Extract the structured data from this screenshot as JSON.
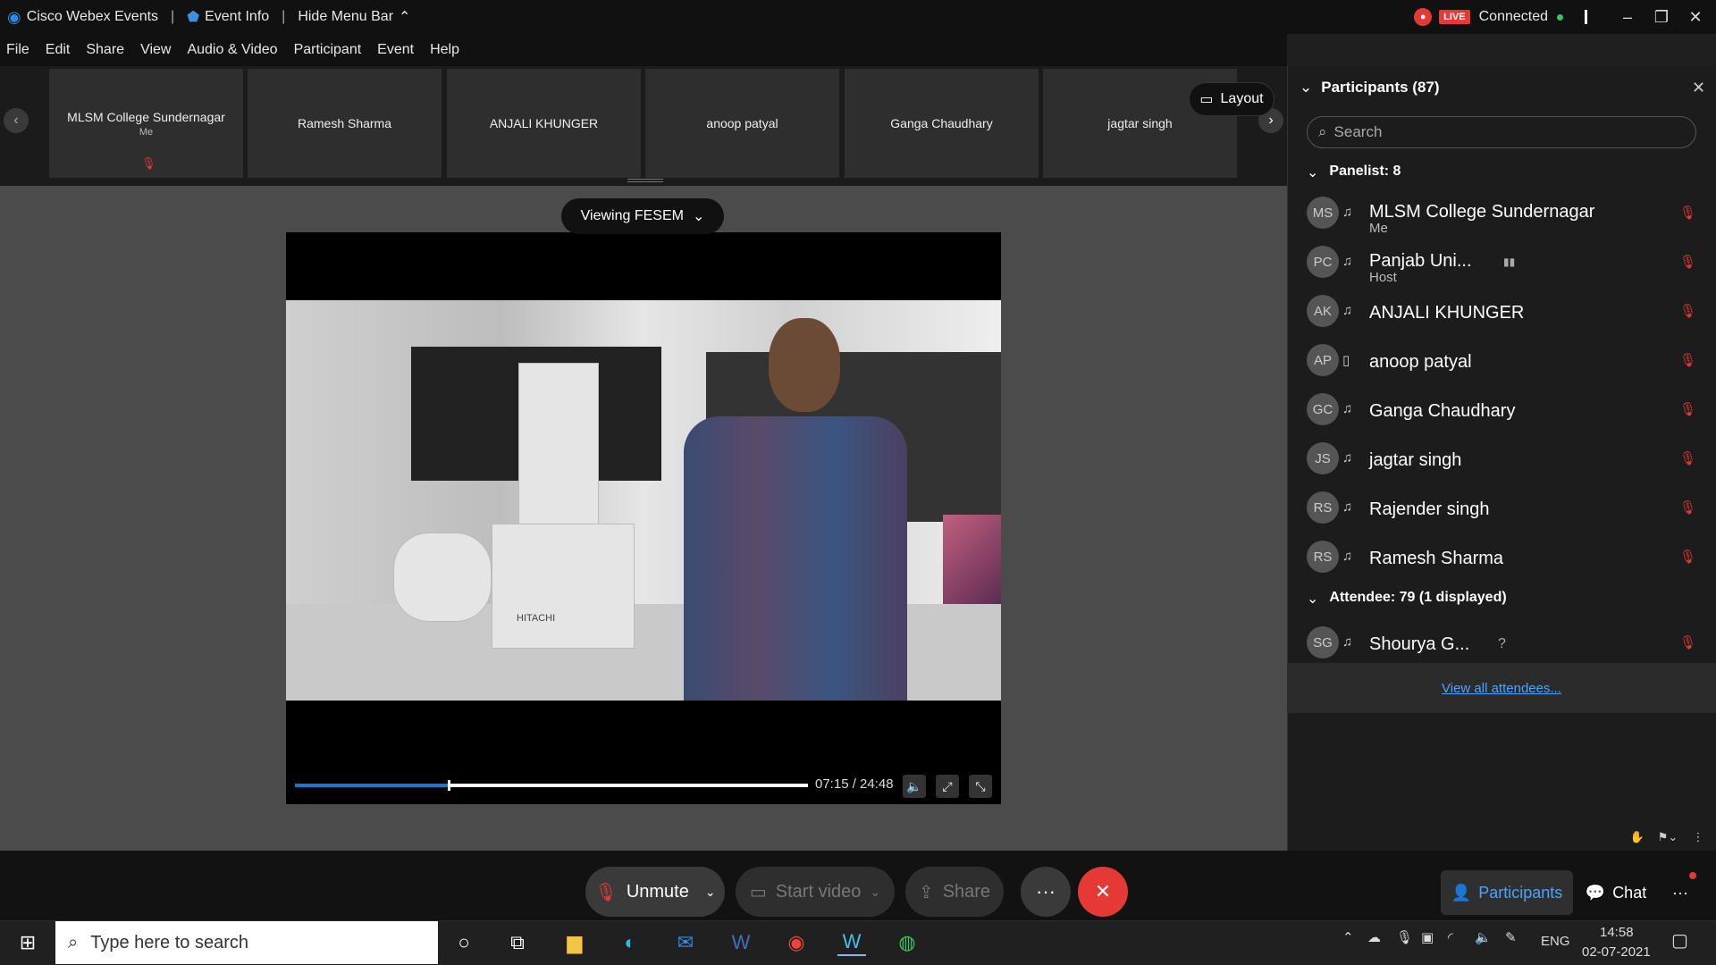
{
  "titlebar": {
    "app_name": "Cisco Webex Events",
    "event_info": "Event Info",
    "hide_menu": "Hide Menu Bar",
    "live": "LIVE",
    "connection": "Connected"
  },
  "menu": [
    "File",
    "Edit",
    "Share",
    "View",
    "Audio & Video",
    "Participant",
    "Event",
    "Help"
  ],
  "filmstrip": [
    {
      "name": "MLSM College Sundernagar",
      "sub": "Me",
      "muted": true
    },
    {
      "name": "Ramesh Sharma",
      "sub": "",
      "muted": false
    },
    {
      "name": "ANJALI KHUNGER",
      "sub": "",
      "muted": false
    },
    {
      "name": "anoop patyal",
      "sub": "",
      "muted": false
    },
    {
      "name": "Ganga Chaudhary",
      "sub": "",
      "muted": false
    },
    {
      "name": "jagtar singh",
      "sub": "",
      "muted": false
    }
  ],
  "layout_label": "Layout",
  "viewing_label": "Viewing FESEM",
  "video": {
    "brand_text": "HITACHI",
    "progress_fraction": 0.3,
    "timecode": "07:15 / 24:48"
  },
  "panel": {
    "title": "Participants (87)",
    "search_placeholder": "Search",
    "panelist_header": "Panelist: 8",
    "attendee_header": "Attendee: 79 (1 displayed)",
    "view_all": "View all attendees...",
    "panelists": [
      {
        "initials": "MS",
        "name": "MLSM College Sundernagar",
        "role": "Me"
      },
      {
        "initials": "PC",
        "name": "Panjab Uni...",
        "role": "Host"
      },
      {
        "initials": "AK",
        "name": "ANJALI KHUNGER",
        "role": ""
      },
      {
        "initials": "AP",
        "name": "anoop patyal",
        "role": ""
      },
      {
        "initials": "GC",
        "name": "Ganga Chaudhary",
        "role": ""
      },
      {
        "initials": "JS",
        "name": "jagtar singh",
        "role": ""
      },
      {
        "initials": "RS",
        "name": "Rajender singh",
        "role": ""
      },
      {
        "initials": "RS",
        "name": "Ramesh Sharma",
        "role": ""
      }
    ],
    "attendees": [
      {
        "initials": "SG",
        "name": "Shourya G...",
        "extra": "?"
      }
    ]
  },
  "controls": {
    "unmute": "Unmute",
    "start_video": "Start video",
    "share": "Share",
    "more": "···",
    "participants": "Participants",
    "chat": "Chat"
  },
  "taskbar": {
    "search_placeholder": "Type here to search",
    "language": "ENG",
    "time": "14:58",
    "date": "02-07-2021"
  }
}
